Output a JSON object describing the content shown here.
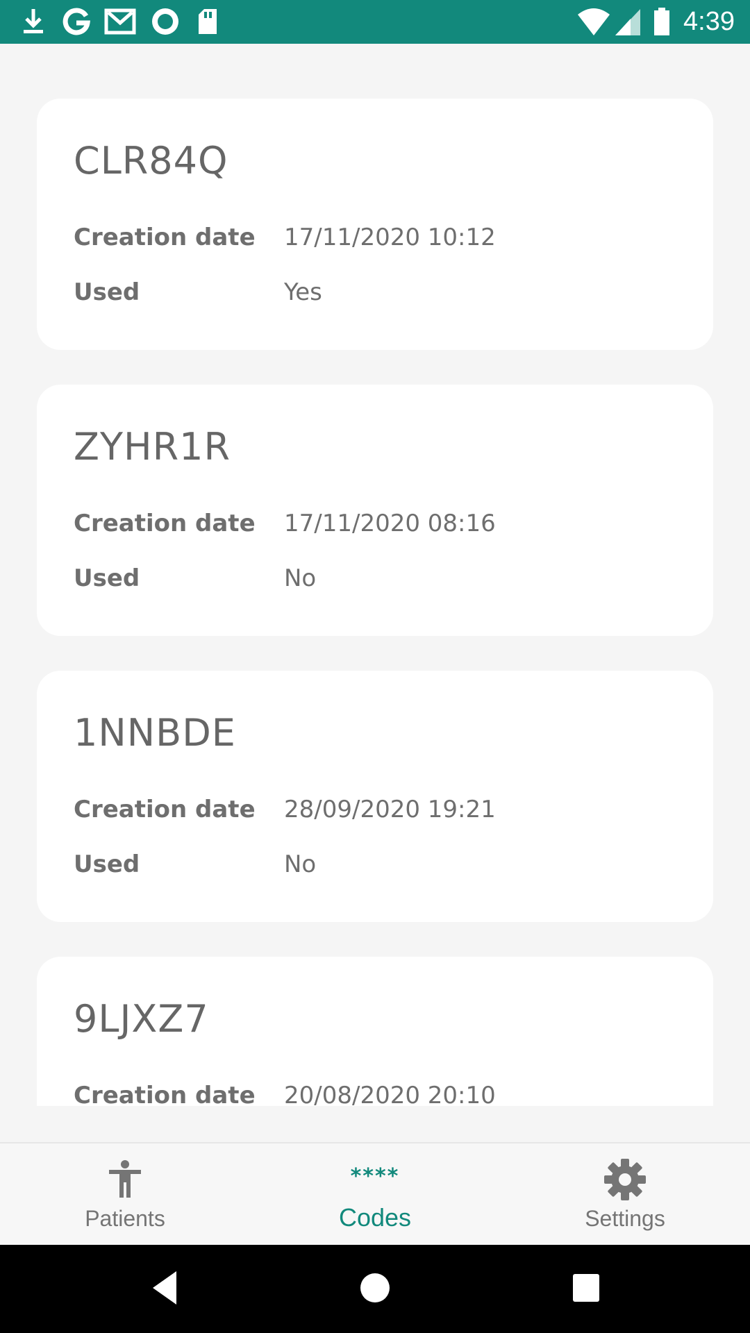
{
  "status_bar": {
    "time": "4:39",
    "left_icons": [
      "download-icon",
      "google-icon",
      "gmail-icon",
      "record-icon",
      "sd-card-icon"
    ],
    "right_icons": [
      "wifi-icon",
      "cell-signal-icon",
      "battery-icon"
    ],
    "background_color": "#12897c"
  },
  "cards": [
    {
      "code": "CLR84Q",
      "creation_label": "Creation date",
      "creation_value": "17/11/2020 10:12",
      "used_label": "Used",
      "used_value": "Yes"
    },
    {
      "code": "ZYHR1R",
      "creation_label": "Creation date",
      "creation_value": "17/11/2020 08:16",
      "used_label": "Used",
      "used_value": "No"
    },
    {
      "code": "1NNBDE",
      "creation_label": "Creation date",
      "creation_value": "28/09/2020 19:21",
      "used_label": "Used",
      "used_value": "No"
    },
    {
      "code": "9LJXZ7",
      "creation_label": "Creation date",
      "creation_value": "20/08/2020 20:10"
    }
  ],
  "bottom_nav": {
    "items": [
      {
        "label": "Patients",
        "icon": "accessibility-person-icon",
        "active": false
      },
      {
        "label": "Codes",
        "icon": "****",
        "active": true
      },
      {
        "label": "Settings",
        "icon": "gear-icon",
        "active": false
      }
    ],
    "accent_color": "#12897c"
  },
  "system_nav": [
    "back-icon",
    "home-icon",
    "recents-icon"
  ]
}
